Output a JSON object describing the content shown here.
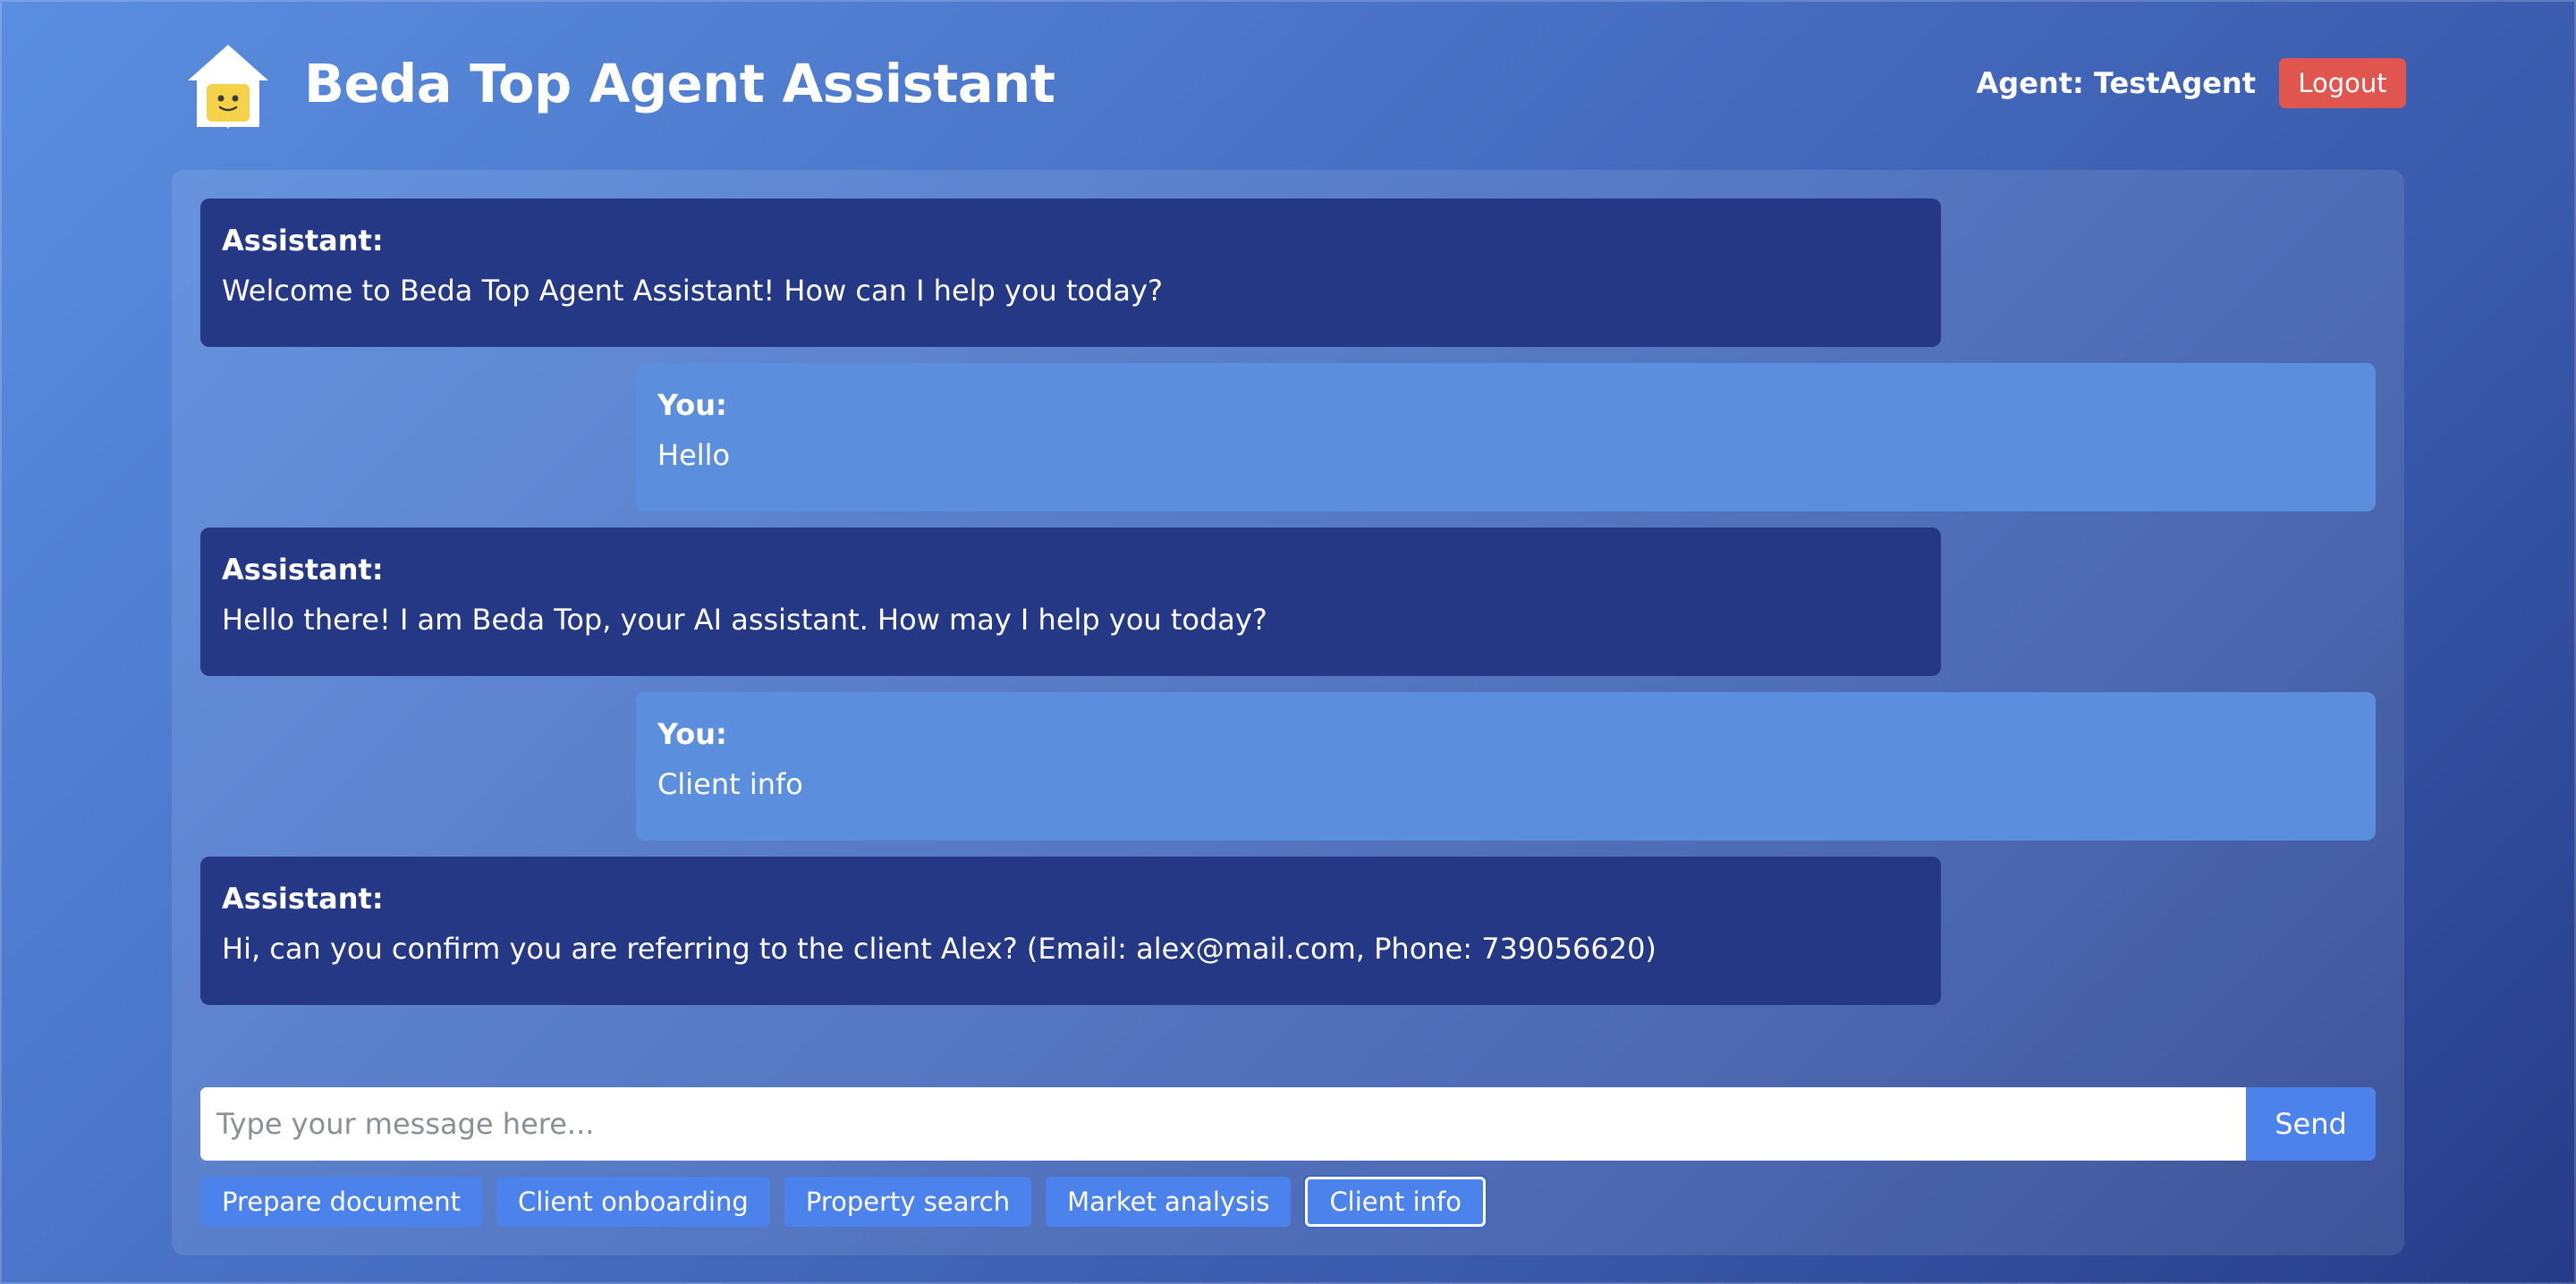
{
  "header": {
    "title": "Beda Top Agent Assistant",
    "logo_icon": "house-robot-icon",
    "agent_label": "Agent: TestAgent",
    "logout_label": "Logout"
  },
  "colors": {
    "assistant_bubble": "#253886",
    "user_bubble": "#5b8edc",
    "logout": "#e1554f",
    "primary_button": "#4c82ec"
  },
  "messages": [
    {
      "role": "assistant",
      "sender": "Assistant:",
      "text": "Welcome to Beda Top Agent Assistant! How can I help you today?"
    },
    {
      "role": "user",
      "sender": "You:",
      "text": "Hello"
    },
    {
      "role": "assistant",
      "sender": "Assistant:",
      "text": "Hello there! I am Beda Top, your AI assistant. How may I help you today?"
    },
    {
      "role": "user",
      "sender": "You:",
      "text": "Client info"
    },
    {
      "role": "assistant",
      "sender": "Assistant:",
      "text": "Hi, can you confirm you are referring to the client Alex? (Email: alex@mail.com, Phone: 739056620)"
    }
  ],
  "composer": {
    "placeholder": "Type your message here...",
    "value": "",
    "send_label": "Send"
  },
  "quick_actions": [
    {
      "label": "Prepare document",
      "active": false
    },
    {
      "label": "Client onboarding",
      "active": false
    },
    {
      "label": "Property search",
      "active": false
    },
    {
      "label": "Market analysis",
      "active": false
    },
    {
      "label": "Client info",
      "active": true
    }
  ]
}
